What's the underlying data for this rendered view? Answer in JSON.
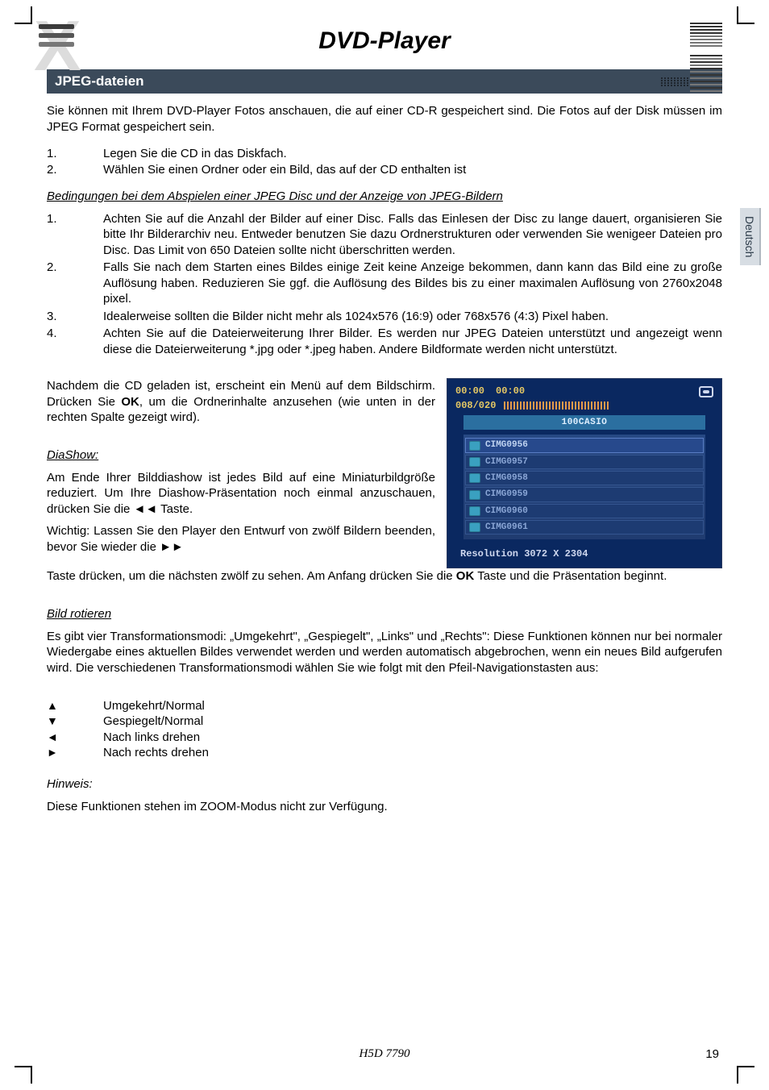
{
  "title": "DVD-Player",
  "section_header": "JPEG-dateien",
  "side_tab": "Deutsch",
  "intro": "Sie können mit Ihrem DVD-Player Fotos anschauen, die auf einer CD-R gespeichert sind. Die Fotos auf der Disk müssen im JPEG Format gespeichert sein.",
  "steps": [
    {
      "n": "1.",
      "t": "Legen Sie die CD in das Diskfach."
    },
    {
      "n": "2.",
      "t": "Wählen Sie einen Ordner oder ein Bild, das auf der CD enthalten ist"
    }
  ],
  "conditions_heading": "Bedingungen bei dem Abspielen einer JPEG Disc und der Anzeige von JPEG-Bildern",
  "conditions": [
    {
      "n": "1.",
      "t": "Achten Sie auf die Anzahl der Bilder auf einer Disc. Falls das Einlesen der Disc zu lange dauert, organisieren Sie bitte Ihr Bilderarchiv neu. Entweder benutzen Sie dazu Ordnerstrukturen oder verwenden Sie wenigeer Dateien pro Disc. Das Limit von 650 Dateien sollte nicht überschritten werden."
    },
    {
      "n": "2.",
      "t": "Falls Sie nach dem Starten eines Bildes einige Zeit keine Anzeige bekommen, dann kann das Bild eine zu große Auflösung haben. Reduzieren Sie ggf. die Auflösung des Bildes bis zu einer maximalen Auflösung von 2760x2048 pixel."
    },
    {
      "n": "3.",
      "t": "Idealerweise sollten die Bilder nicht mehr als 1024x576 (16:9) oder 768x576 (4:3) Pixel haben."
    },
    {
      "n": "4.",
      "t": "Achten Sie auf die Dateierweiterung Ihrer Bilder. Es werden nur JPEG Dateien unterstützt und angezeigt wenn diese die Dateierweiterung *.jpg oder *.jpeg haben. Andere Bildformate werden nicht unterstützt."
    }
  ],
  "after_load_prefix": "Nachdem die CD geladen ist, erscheint ein Menü auf dem Bildschirm. Drücken Sie ",
  "after_load_ok": "OK",
  "after_load_suffix": ", um die Ordnerinhalte anzusehen (wie unten in der rechten Spalte gezeigt wird).",
  "diashow_heading": "DiaShow:",
  "diashow_body": "Am Ende Ihrer Bilddiashow ist jedes Bild auf eine Miniaturbildgröße reduziert. Um Ihre Diashow-Präsentation noch einmal anzuschauen, drücken Sie die ◄◄  Taste.",
  "diashow_important": "Wichtig: Lassen Sie den Player den Entwurf von zwölf Bildern beenden, bevor Sie wieder die ►►",
  "diashow_continued_prefix": "Taste drücken, um die nächsten zwölf zu sehen. Am Anfang drücken Sie die ",
  "diashow_continued_ok": "OK",
  "diashow_continued_suffix": " Taste und die Präsentation beginnt.",
  "rotate_heading": "Bild rotieren",
  "rotate_body": "Es gibt vier Transformationsmodi: „Umgekehrt\", „Gespiegelt\", „Links\" und „Rechts\": Diese Funktionen können nur bei normaler Wiedergabe eines aktuellen Bildes verwendet werden und werden automatisch abgebrochen, wenn ein neues Bild aufgerufen wird. Die verschiedenen Transformationsmodi wählen Sie wie folgt mit den Pfeil-Navigationstasten aus:",
  "arrows": [
    {
      "s": "▲",
      "t": "Umgekehrt/Normal"
    },
    {
      "s": "▼",
      "t": "Gespiegelt/Normal"
    },
    {
      "s": "◄",
      "t": "Nach links drehen"
    },
    {
      "s": "►",
      "t": "Nach rechts drehen"
    }
  ],
  "note_heading": "Hinweis:",
  "note_body": "Diese Funktionen stehen im ZOOM-Modus nicht zur Verfügung.",
  "screenshot": {
    "time_left": "00:00",
    "time_right": "00:00",
    "counter": "008/020",
    "folder_label": "100CASIO",
    "files": [
      "CIMG0956",
      "CIMG0957",
      "CIMG0958",
      "CIMG0959",
      "CIMG0960",
      "CIMG0961"
    ],
    "resolution_line": "Resolution  3072  X  2304"
  },
  "footer_model": "H5D 7790",
  "page_number": "19"
}
